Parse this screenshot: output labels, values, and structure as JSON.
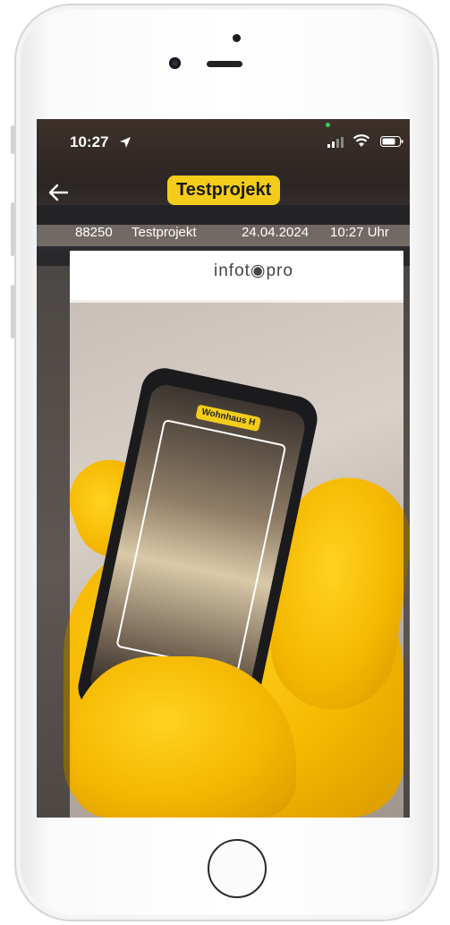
{
  "status_bar": {
    "time": "10:27",
    "location_icon": "location-arrow-icon",
    "signal_icon": "cellular-signal-icon",
    "wifi_icon": "wifi-icon",
    "battery_icon": "battery-icon"
  },
  "header": {
    "back_icon": "arrow-left-icon",
    "title": "Testprojekt",
    "title_color": "#f4cc1a"
  },
  "info_row": {
    "project_number": "88250",
    "project_name": "Testprojekt",
    "date": "24.04.2024",
    "time": "10:27 Uhr"
  },
  "camera_view": {
    "logo_text": "infot◉pro",
    "inner_app_badge": "Wohnhaus H"
  },
  "device": {
    "home_button_icon": "home-button-icon"
  }
}
